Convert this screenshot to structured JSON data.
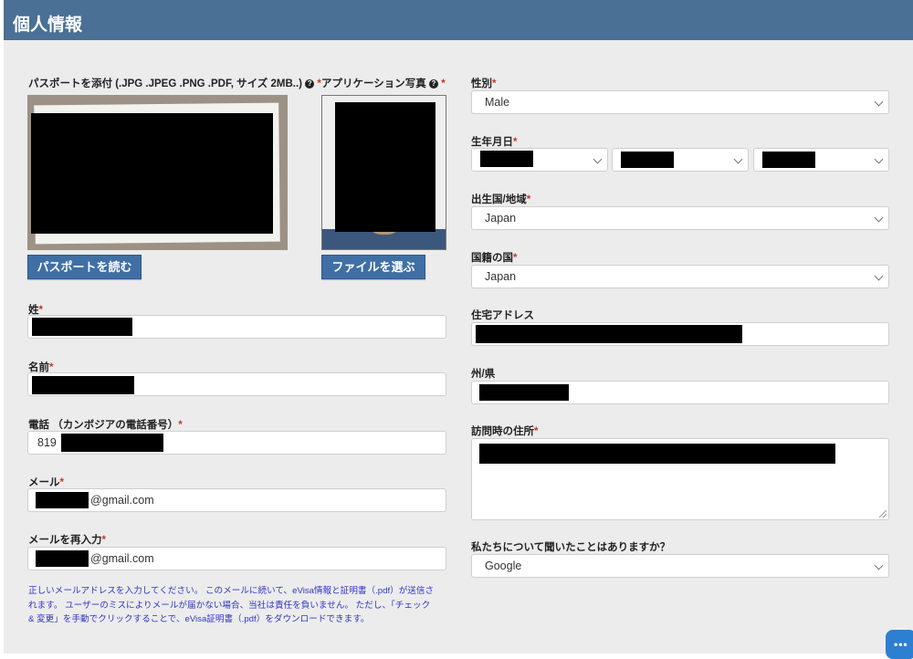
{
  "header": {
    "title": "個人情報"
  },
  "passport": {
    "label": "パスポートを添付 (.JPG .JPEG .PNG .PDF, サイズ 2MB..)",
    "button": "パスポートを読む"
  },
  "photo": {
    "label": "アプリケーション写真",
    "button": "ファイルを選ぶ"
  },
  "fields": {
    "surname_label": "姓",
    "given_name_label": "名前",
    "phone_label": "電話 （カンボジアの電話番号）",
    "phone_prefix": "819",
    "email_label": "メール",
    "email_suffix": "@gmail.com",
    "email_confirm_label": "メールを再入力",
    "email_confirm_suffix": "@gmail.com",
    "gender_label": "性別",
    "gender_value": "Male",
    "dob_label": "生年月日",
    "birth_country_label": "出生国/地域",
    "birth_country_value": "Japan",
    "nationality_label": "国籍の国",
    "nationality_value": "Japan",
    "address_label": "住宅アドレス",
    "state_label": "州/県",
    "visit_address_label": "訪問時の住所",
    "referral_label": "私たちについて聞いたことはありますか？",
    "referral_value": "Google"
  },
  "notice": {
    "line1": "正しいメールアドレスを入力してください。 このメールに続いて、eVisa情報と証明書（.pdf）が送信さ",
    "line2": "れます。 ユーザーのミスによりメールが届かない場合、当社は責任を負いません。 ただし、「チェック",
    "line3": "& 変更」を手動でクリックすることで、eVisa証明書（.pdf）をダウンロードできます。"
  },
  "required_marker": "*",
  "help_icon": "?",
  "icons": [
    "question-circle-icon",
    "chevron-down-icon",
    "chat-icon",
    "resize-handle-icon"
  ],
  "colors": {
    "header_bg": "#4a7095",
    "button_bg": "#3f6fa5",
    "required": "#c0392b",
    "notice_text": "#2f35c9",
    "panel_bg": "#ececec"
  }
}
